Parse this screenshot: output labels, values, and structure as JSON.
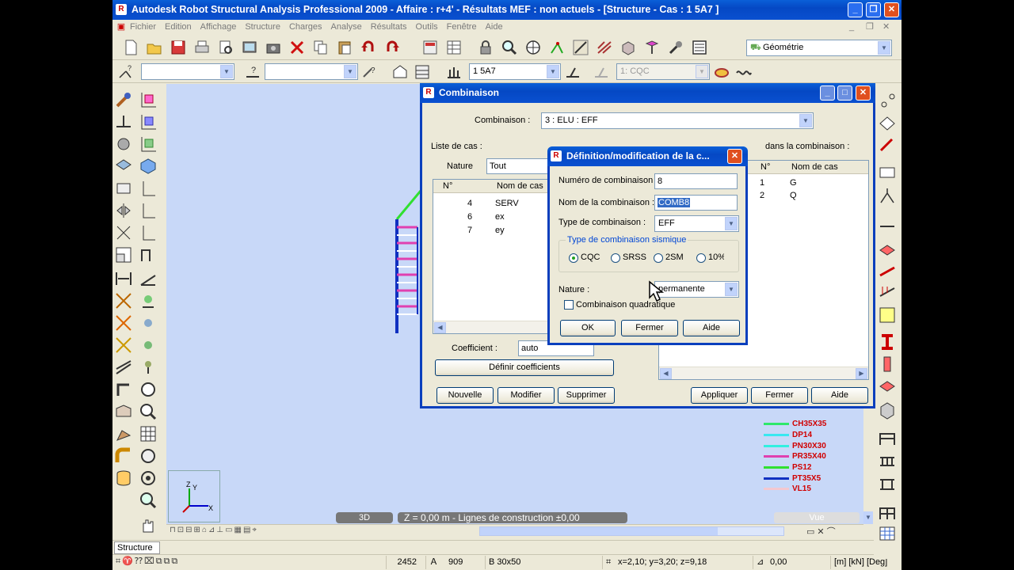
{
  "window": {
    "title": "Autodesk Robot Structural Analysis Professional 2009  -  Affaire : r+4'  - Résultats MEF : non actuels  - [Structure  - Cas : 1 5A7  ]"
  },
  "menu": [
    "Fichier",
    "Edition",
    "Affichage",
    "Structure",
    "Charges",
    "Analyse",
    "Résultats",
    "Outils",
    "Fenêtre",
    "Aide"
  ],
  "toolbar2": {
    "combo1": "",
    "combo2": "",
    "case_combo": "1 5A7",
    "mode_combo": "1: CQC"
  },
  "view_combo": "Géométrie",
  "combinaison_dialog": {
    "title": "Combinaison",
    "combinaison_label": "Combinaison :",
    "combinaison_value": "3 : ELU : EFF",
    "liste_label": "Liste de cas :",
    "dans_label": "dans la combinaison :",
    "nature_label": "Nature",
    "nature_value": "Tout",
    "left_headers": [
      "N°",
      "Nom de cas"
    ],
    "left_rows": [
      [
        "4",
        "SERV"
      ],
      [
        "6",
        "ex"
      ],
      [
        "7",
        "ey"
      ]
    ],
    "right_headers": [
      "N°",
      "Nom de cas"
    ],
    "right_rows": [
      [
        "1",
        "G"
      ],
      [
        "2",
        "Q"
      ]
    ],
    "coefficient_label": "Coefficient :",
    "coefficient_value": "auto",
    "definir_button": "Définir coefficients",
    "buttons": {
      "nouvelle": "Nouvelle",
      "modifier": "Modifier",
      "supprimer": "Supprimer",
      "appliquer": "Appliquer",
      "fermer": "Fermer",
      "aide": "Aide"
    }
  },
  "definition_dialog": {
    "title": "Définition/modification de la c...",
    "numero_label": "Numéro de combinaison :",
    "numero_value": "8",
    "nom_label": "Nom de la combinaison :",
    "nom_value": "COMB8",
    "type_label": "Type de combinaison :",
    "type_value": "EFF",
    "sismique_group": "Type de combinaison sismique",
    "radios": [
      "CQC",
      "SRSS",
      "2SM",
      "10%"
    ],
    "selected_radio": "CQC",
    "nature_label": "Nature :",
    "nature_value": "permanente",
    "quadratique_label": "Combinaison quadratique",
    "buttons": {
      "ok": "OK",
      "fermer": "Fermer",
      "aide": "Aide"
    }
  },
  "legend": [
    {
      "label": "CH35X35",
      "color": "#2ee86a"
    },
    {
      "label": "DP14",
      "color": "#38e8f0"
    },
    {
      "label": "PN30X30",
      "color": "#30f0e0"
    },
    {
      "label": "PR35X40",
      "color": "#e040b0"
    },
    {
      "label": "PS12",
      "color": "#30e030"
    },
    {
      "label": "PT35X5",
      "color": "#1030c0"
    },
    {
      "label": "VL15",
      "color": "#f4c8d0"
    }
  ],
  "viewbar": {
    "mode": "3D",
    "plane": "Z = 0,00 m - Lignes de construction ±0,00",
    "vue": "Vue"
  },
  "tab": "Structure",
  "status": {
    "count": "2452",
    "nodes": "909",
    "section": "B 30x50",
    "coords": "x=2,10; y=3,20; z=9,18",
    "angle": "0,00",
    "units": "[m] [kN] [Deg]"
  }
}
